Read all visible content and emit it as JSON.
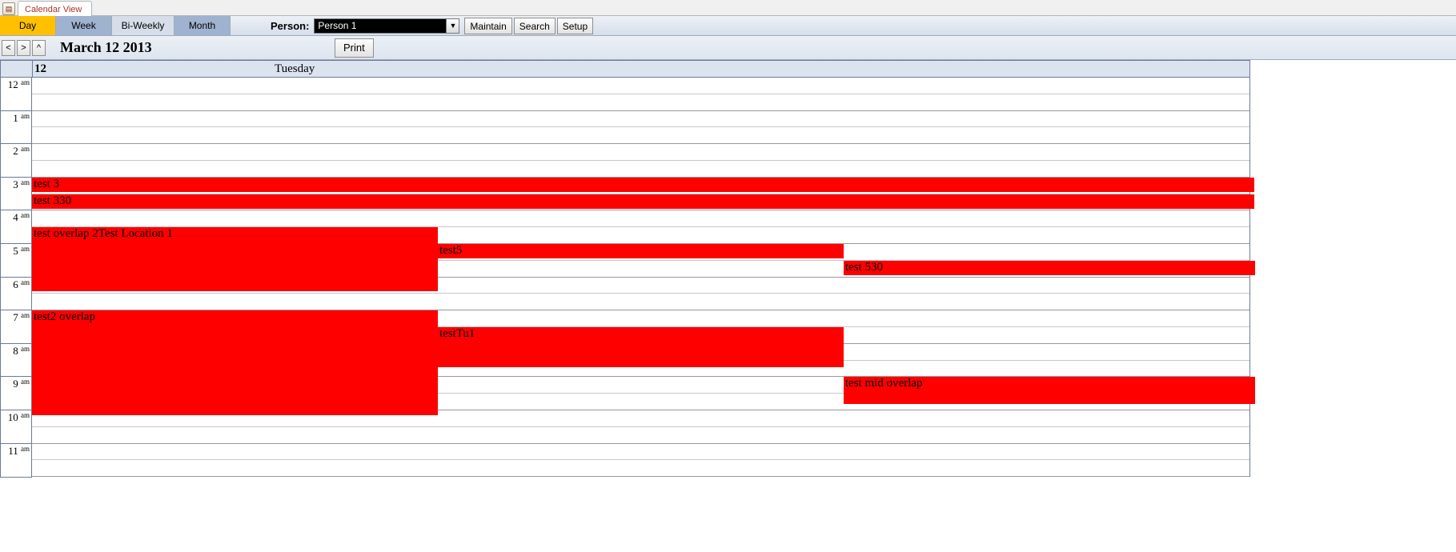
{
  "tab": {
    "title": "Calendar View"
  },
  "views": {
    "day": "Day",
    "week": "Week",
    "biweekly": "Bi-Weekly",
    "month": "Month"
  },
  "person": {
    "label": "Person:",
    "value": "Person 1"
  },
  "buttons": {
    "maintain": "Maintain",
    "search": "Search",
    "setup": "Setup",
    "print": "Print",
    "prev": "<",
    "next": ">",
    "up": "^"
  },
  "date": {
    "title": "March 12 2013",
    "dayNumber": "12",
    "dayName": "Tuesday"
  },
  "hours": {
    "times": [
      "12",
      "1",
      "2",
      "3",
      "4",
      "5",
      "6",
      "7",
      "8",
      "9",
      "10",
      "11"
    ],
    "suffix": "am"
  },
  "events": {
    "e1": "test 3",
    "e2": "test 330",
    "e3": "test overlap 2Test Location 1",
    "e4": "test5",
    "e5": "test 530",
    "e6": "test2 overlap",
    "e7": "testTu1",
    "e8": "test mid overlap"
  }
}
